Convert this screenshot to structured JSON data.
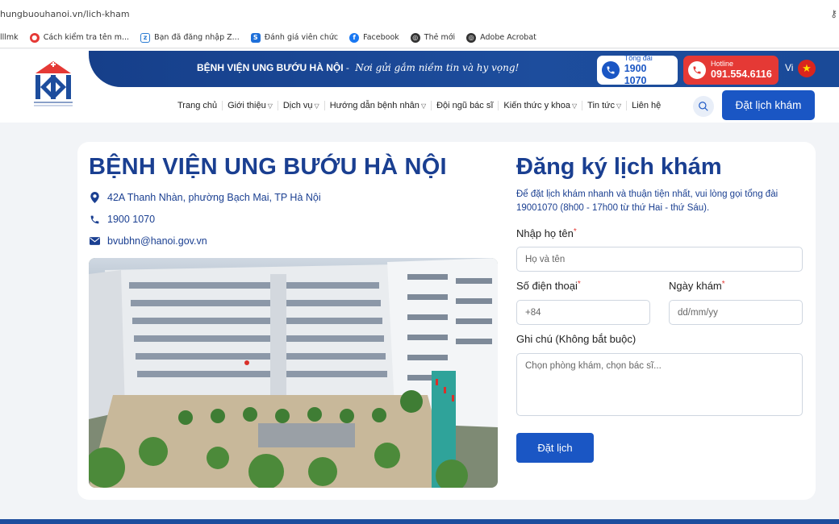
{
  "browser": {
    "url": "hungbuouhanoi.vn/lich-kham",
    "bookmarks": [
      {
        "label": "lllmk",
        "icon": "none"
      },
      {
        "label": "Cách kiểm tra tên m...",
        "icon": "circle-red-icon"
      },
      {
        "label": "Bạn đã đăng nhập Z...",
        "icon": "zalo-icon"
      },
      {
        "label": "Đánh giá viên chức",
        "icon": "document-icon"
      },
      {
        "label": "Facebook",
        "icon": "facebook-icon"
      },
      {
        "label": "Thẻ mới",
        "icon": "globe-icon"
      },
      {
        "label": "Adobe Acrobat",
        "icon": "globe-icon"
      }
    ]
  },
  "header": {
    "tagline_bold": "BỆNH VIỆN UNG BƯỚU HÀ NỘI",
    "tagline_sep": "-",
    "tagline_slogan": "Nơi gửi gắm niềm tin và hy vọng!",
    "tongdai_label": "Tổng đài",
    "tongdai_number": "1900 1070",
    "hotline_label": "Hotline",
    "hotline_number": "091.554.6116",
    "lang": "Vi",
    "flag_star": "★",
    "nav": [
      {
        "label": "Trang chủ",
        "dropdown": false
      },
      {
        "label": "Giới thiệu",
        "dropdown": true
      },
      {
        "label": "Dịch vụ",
        "dropdown": true
      },
      {
        "label": "Hướng dẫn bệnh nhân",
        "dropdown": true
      },
      {
        "label": "Đội ngũ bác sĩ",
        "dropdown": false
      },
      {
        "label": "Kiến thức y khoa",
        "dropdown": true
      },
      {
        "label": "Tin tức",
        "dropdown": true
      },
      {
        "label": "Liên hệ",
        "dropdown": false
      }
    ],
    "book_button": "Đặt lịch khám"
  },
  "hospital": {
    "name": "BỆNH VIỆN UNG BƯỚU HÀ NỘI",
    "address": "42A Thanh Nhàn, phường Bạch Mai, TP Hà Nội",
    "phone": "1900 1070",
    "email": "bvubhn@hanoi.gov.vn"
  },
  "form": {
    "title": "Đăng ký lịch khám",
    "description": "Để đặt lịch khám nhanh và thuận tiện nhất, vui lòng gọi tổng đài 19001070 (8h00 - 17h00 từ thứ Hai - thứ Sáu).",
    "name_label": "Nhập họ tên",
    "name_placeholder": "Họ và tên",
    "phone_label": "Số điện thoại",
    "phone_placeholder": "+84",
    "date_label": "Ngày khám",
    "date_placeholder": "dd/mm/yy",
    "note_label": "Ghi chú (Không bắt buộc)",
    "note_placeholder": "Chọn phòng khám, chọn bác sĩ...",
    "required_mark": "*",
    "submit": "Đặt lịch"
  },
  "colors": {
    "brand_blue": "#1a3f91",
    "button_blue": "#1a56c4",
    "hotline_red": "#e53935"
  }
}
